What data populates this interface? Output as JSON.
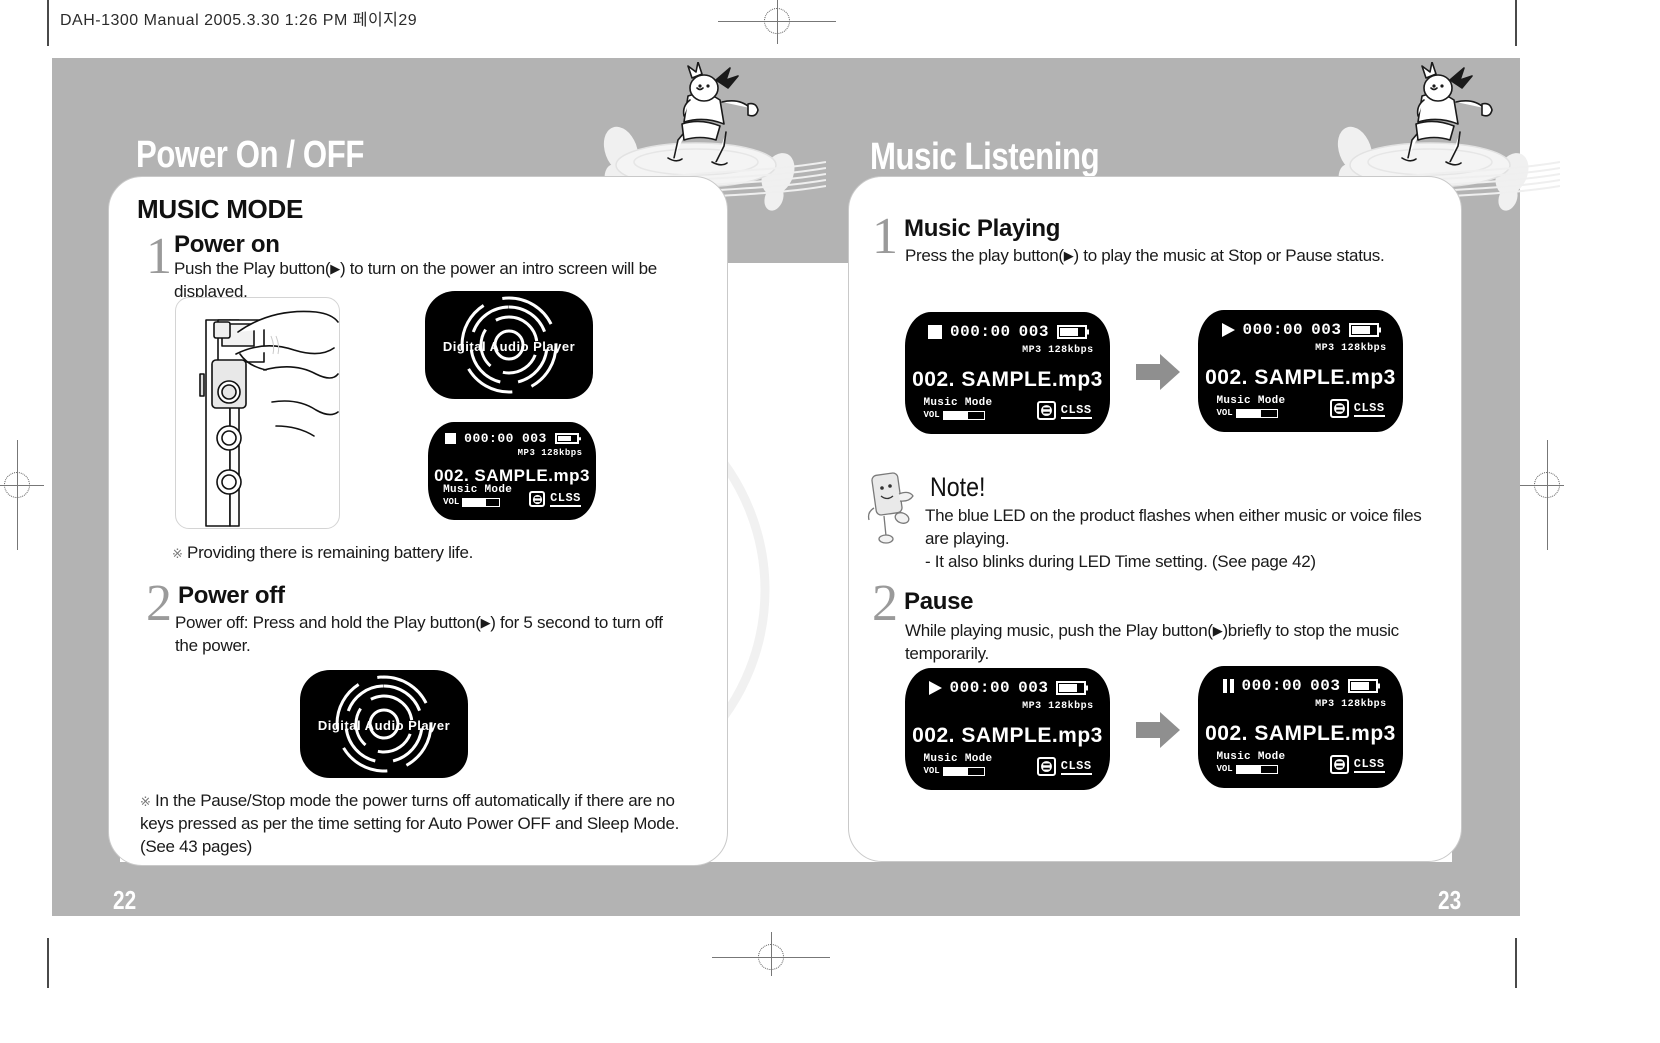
{
  "scan": {
    "header": "DAH-1300 Manual  2005.3.30 1:26 PM  페이지29"
  },
  "left_page": {
    "number": "22",
    "chapter_title": "Power On / OFF",
    "mode_label": "MUSIC MODE",
    "steps": [
      {
        "num": "1",
        "title": "Power on",
        "body_pre": "Push the Play button(",
        "body_post": ") to turn on the power an intro screen will be displayed.",
        "footnote": "Providing there is remaining battery life."
      },
      {
        "num": "2",
        "title": "Power off",
        "body_pre": "Power off: Press and hold the Play button(",
        "body_post": ")  for 5 second to turn off the power.",
        "footnote": "In the Pause/Stop mode the power turns off automatically if there are no keys pressed as per the time setting for Auto Power OFF and Sleep Mode. (See 43 pages)"
      }
    ],
    "intro_screen": {
      "label": "Digital Audio Player"
    },
    "status_screen": {
      "state": "stop",
      "time": "000:00",
      "track_no": "003",
      "codec": "MP3 128kbps",
      "filename": "002. SAMPLE.mp3",
      "mode": "Music Mode",
      "vol_label": "VOL",
      "vol_percent": 62,
      "eq": "CLSS",
      "battery_percent": 75
    },
    "illustration": "hand-pressing-play-button-line-art"
  },
  "right_page": {
    "number": "23",
    "chapter_title": "Music Listening",
    "steps": [
      {
        "num": "1",
        "title": "Music Playing",
        "body_pre": "Press the play button(",
        "body_post": ") to play the music at Stop or Pause status."
      },
      {
        "num": "2",
        "title": "Pause",
        "body_pre": "While playing music, push the Play button(",
        "body_post": ")briefly to stop the music temporarily."
      }
    ],
    "note": {
      "title": "Note!",
      "line1": "The blue LED on the product flashes when either music or voice files are playing.",
      "line2": "- It also blinks during LED Time setting. (See page 42)"
    },
    "screens_row1": [
      {
        "state": "stop",
        "time": "000:00",
        "track_no": "003",
        "codec": "MP3 128kbps",
        "filename": "002. SAMPLE.mp3",
        "mode": "Music Mode",
        "vol_label": "VOL",
        "vol_percent": 62,
        "eq": "CLSS",
        "battery_percent": 75
      },
      {
        "state": "play",
        "time": "000:00",
        "track_no": "003",
        "codec": "MP3 128kbps",
        "filename": "002. SAMPLE.mp3",
        "mode": "Music Mode",
        "vol_label": "VOL",
        "vol_percent": 62,
        "eq": "CLSS",
        "battery_percent": 75
      }
    ],
    "screens_row2": [
      {
        "state": "play",
        "time": "000:00",
        "track_no": "003",
        "codec": "MP3 128kbps",
        "filename": "002. SAMPLE.mp3",
        "mode": "Music Mode",
        "vol_label": "VOL",
        "vol_percent": 62,
        "eq": "CLSS",
        "battery_percent": 75
      },
      {
        "state": "pause",
        "time": "000:00",
        "track_no": "003",
        "codec": "MP3 128kbps",
        "filename": "002. SAMPLE.mp3",
        "mode": "Music Mode",
        "vol_label": "VOL",
        "vol_percent": 62,
        "eq": "CLSS",
        "battery_percent": 75
      }
    ]
  },
  "glyphs": {
    "play_triangle": "▶",
    "reference_mark": "※"
  },
  "colors": {
    "band_gray": "#b3b3b3",
    "lcd_black": "#000000",
    "arrow_gray": "#8f8f8f",
    "step_number_gray": "#9a9a9a",
    "watermark": "#f2f2f2"
  }
}
